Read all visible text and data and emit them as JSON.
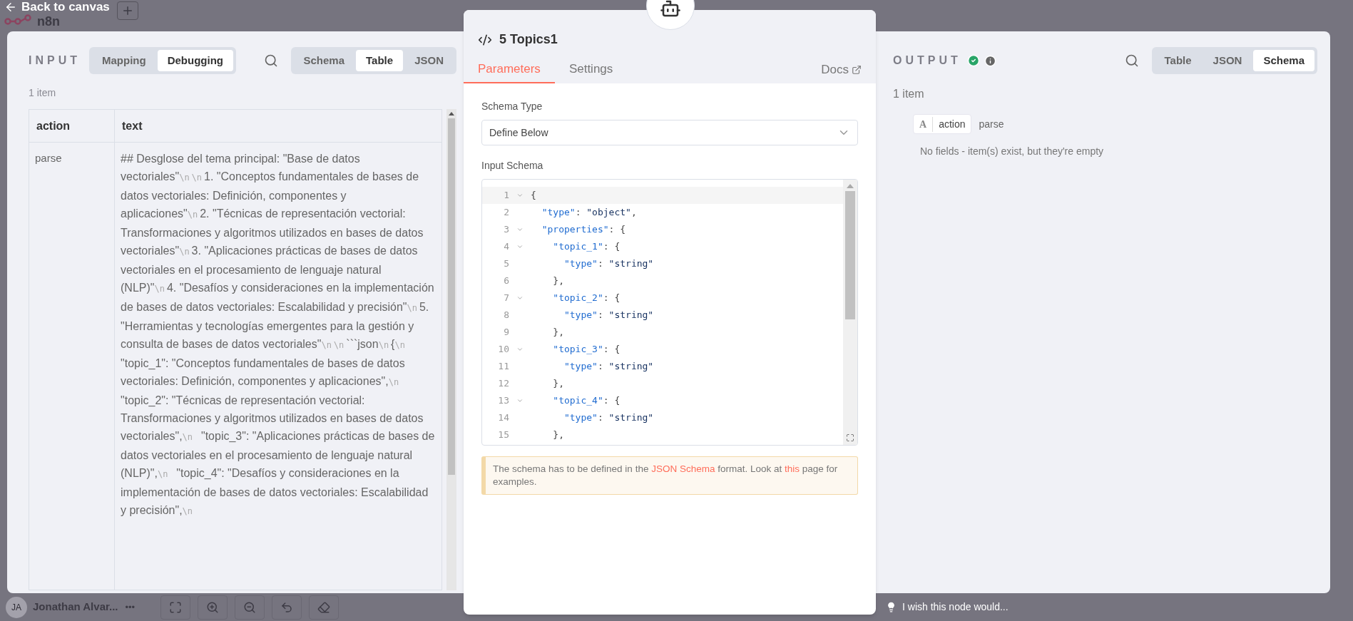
{
  "header": {
    "back_link": "Back to canvas",
    "logo": "n8n"
  },
  "input_panel": {
    "title": "INPUT",
    "mode_tabs": [
      {
        "label": "Mapping",
        "selected": false
      },
      {
        "label": "Debugging",
        "selected": true
      }
    ],
    "view_tabs": [
      {
        "label": "Schema",
        "selected": false
      },
      {
        "label": "Table",
        "selected": true
      },
      {
        "label": "JSON",
        "selected": false
      }
    ],
    "item_count": "1 item",
    "table": {
      "columns": [
        "action",
        "text"
      ],
      "rows": [
        {
          "action": "parse",
          "text_parts": [
            {
              "kind": "text",
              "value": "## Desglose del tema principal: \"Base de datos vectoriales\""
            },
            {
              "kind": "escape",
              "value": "\\n"
            },
            {
              "kind": "escape",
              "value": "\\n"
            },
            {
              "kind": "text",
              "value": "1. \"Conceptos fundamentales de bases de datos vectoriales: Definición, componentes y aplicaciones\""
            },
            {
              "kind": "escape",
              "value": "\\n"
            },
            {
              "kind": "text",
              "value": "2. \"Técnicas de representación vectorial: Transformaciones y algoritmos utilizados en bases de datos vectoriales\""
            },
            {
              "kind": "escape",
              "value": "\\n"
            },
            {
              "kind": "text",
              "value": "3. \"Aplicaciones prácticas de bases de datos vectoriales en el procesamiento de lenguaje natural (NLP)\""
            },
            {
              "kind": "escape",
              "value": "\\n"
            },
            {
              "kind": "text",
              "value": "4. \"Desafíos y consideraciones en la implementación de bases de datos vectoriales: Escalabilidad y precisión\""
            },
            {
              "kind": "escape",
              "value": "\\n"
            },
            {
              "kind": "text",
              "value": "5. \"Herramientas y tecnologías emergentes para la gestión y consulta de bases de datos vectoriales\""
            },
            {
              "kind": "escape",
              "value": "\\n"
            },
            {
              "kind": "escape",
              "value": "\\n"
            },
            {
              "kind": "text",
              "value": "```json"
            },
            {
              "kind": "escape",
              "value": "\\n"
            },
            {
              "kind": "text",
              "value": "{"
            },
            {
              "kind": "escape",
              "value": "\\n"
            },
            {
              "kind": "text",
              "value": "  \"topic_1\": \"Conceptos fundamentales de bases de datos vectoriales: Definición, componentes y aplicaciones\","
            },
            {
              "kind": "escape",
              "value": "\\n"
            },
            {
              "kind": "text",
              "value": "  \"topic_2\": \"Técnicas de representación vectorial: Transformaciones y algoritmos utilizados en bases de datos vectoriales\","
            },
            {
              "kind": "escape",
              "value": "\\n"
            },
            {
              "kind": "text",
              "value": "  \"topic_3\": \"Aplicaciones prácticas de bases de datos vectoriales en el procesamiento de lenguaje natural (NLP)\","
            },
            {
              "kind": "escape",
              "value": "\\n"
            },
            {
              "kind": "text",
              "value": "  \"topic_4\": \"Desafíos y consideraciones en la implementación de bases de datos vectoriales: Escalabilidad y precisión\","
            },
            {
              "kind": "escape",
              "value": "\\n"
            }
          ]
        }
      ]
    }
  },
  "node_panel": {
    "title": "5 Topics1",
    "tabs": [
      {
        "label": "Parameters",
        "selected": true
      },
      {
        "label": "Settings",
        "selected": false
      }
    ],
    "docs_link": "Docs",
    "schema_type": {
      "label": "Schema Type",
      "value": "Define Below"
    },
    "input_schema": {
      "label": "Input Schema",
      "lines": [
        {
          "number": "1",
          "foldable": true,
          "active": true,
          "tokens": [
            {
              "kind": "punct",
              "text": "{"
            }
          ]
        },
        {
          "number": "2",
          "foldable": false,
          "active": false,
          "tokens": [
            {
              "kind": "key",
              "text": "  \"type\""
            },
            {
              "kind": "punct",
              "text": ": "
            },
            {
              "kind": "string",
              "text": "\"object\""
            },
            {
              "kind": "punct",
              "text": ","
            }
          ]
        },
        {
          "number": "3",
          "foldable": true,
          "active": false,
          "tokens": [
            {
              "kind": "key",
              "text": "  \"properties\""
            },
            {
              "kind": "punct",
              "text": ": {"
            }
          ]
        },
        {
          "number": "4",
          "foldable": true,
          "active": false,
          "tokens": [
            {
              "kind": "key",
              "text": "    \"topic_1\""
            },
            {
              "kind": "punct",
              "text": ": {"
            }
          ]
        },
        {
          "number": "5",
          "foldable": false,
          "active": false,
          "tokens": [
            {
              "kind": "key",
              "text": "      \"type\""
            },
            {
              "kind": "punct",
              "text": ": "
            },
            {
              "kind": "string",
              "text": "\"string\""
            }
          ]
        },
        {
          "number": "6",
          "foldable": false,
          "active": false,
          "tokens": [
            {
              "kind": "punct",
              "text": "    },"
            }
          ]
        },
        {
          "number": "7",
          "foldable": true,
          "active": false,
          "tokens": [
            {
              "kind": "key",
              "text": "    \"topic_2\""
            },
            {
              "kind": "punct",
              "text": ": {"
            }
          ]
        },
        {
          "number": "8",
          "foldable": false,
          "active": false,
          "tokens": [
            {
              "kind": "key",
              "text": "      \"type\""
            },
            {
              "kind": "punct",
              "text": ": "
            },
            {
              "kind": "string",
              "text": "\"string\""
            }
          ]
        },
        {
          "number": "9",
          "foldable": false,
          "active": false,
          "tokens": [
            {
              "kind": "punct",
              "text": "    },"
            }
          ]
        },
        {
          "number": "10",
          "foldable": true,
          "active": false,
          "tokens": [
            {
              "kind": "key",
              "text": "    \"topic_3\""
            },
            {
              "kind": "punct",
              "text": ": {"
            }
          ]
        },
        {
          "number": "11",
          "foldable": false,
          "active": false,
          "tokens": [
            {
              "kind": "key",
              "text": "      \"type\""
            },
            {
              "kind": "punct",
              "text": ": "
            },
            {
              "kind": "string",
              "text": "\"string\""
            }
          ]
        },
        {
          "number": "12",
          "foldable": false,
          "active": false,
          "tokens": [
            {
              "kind": "punct",
              "text": "    },"
            }
          ]
        },
        {
          "number": "13",
          "foldable": true,
          "active": false,
          "tokens": [
            {
              "kind": "key",
              "text": "    \"topic_4\""
            },
            {
              "kind": "punct",
              "text": ": {"
            }
          ]
        },
        {
          "number": "14",
          "foldable": false,
          "active": false,
          "tokens": [
            {
              "kind": "key",
              "text": "      \"type\""
            },
            {
              "kind": "punct",
              "text": ": "
            },
            {
              "kind": "string",
              "text": "\"string\""
            }
          ]
        },
        {
          "number": "15",
          "foldable": false,
          "active": false,
          "tokens": [
            {
              "kind": "punct",
              "text": "    },"
            }
          ]
        }
      ]
    },
    "notice_parts": [
      {
        "kind": "text",
        "value": "The schema has to be defined in the "
      },
      {
        "kind": "link",
        "value": "JSON Schema"
      },
      {
        "kind": "text",
        "value": " format. Look at "
      },
      {
        "kind": "link",
        "value": "this"
      },
      {
        "kind": "text",
        "value": " page for examples."
      }
    ]
  },
  "output_panel": {
    "title": "OUTPUT",
    "success": true,
    "view_tabs": [
      {
        "label": "Table",
        "selected": false
      },
      {
        "label": "JSON",
        "selected": false
      },
      {
        "label": "Schema",
        "selected": true
      }
    ],
    "item_count": "1 item",
    "schema_fields": [
      {
        "type": "A",
        "name": "action",
        "value": "parse"
      }
    ],
    "empty_note": "No fields - item(s) exist, but they're empty"
  },
  "footer": {
    "user_initials": "JA",
    "user_name": "Jonathan Alvar...",
    "menu": "•••",
    "feedback": "I wish this node would..."
  }
}
